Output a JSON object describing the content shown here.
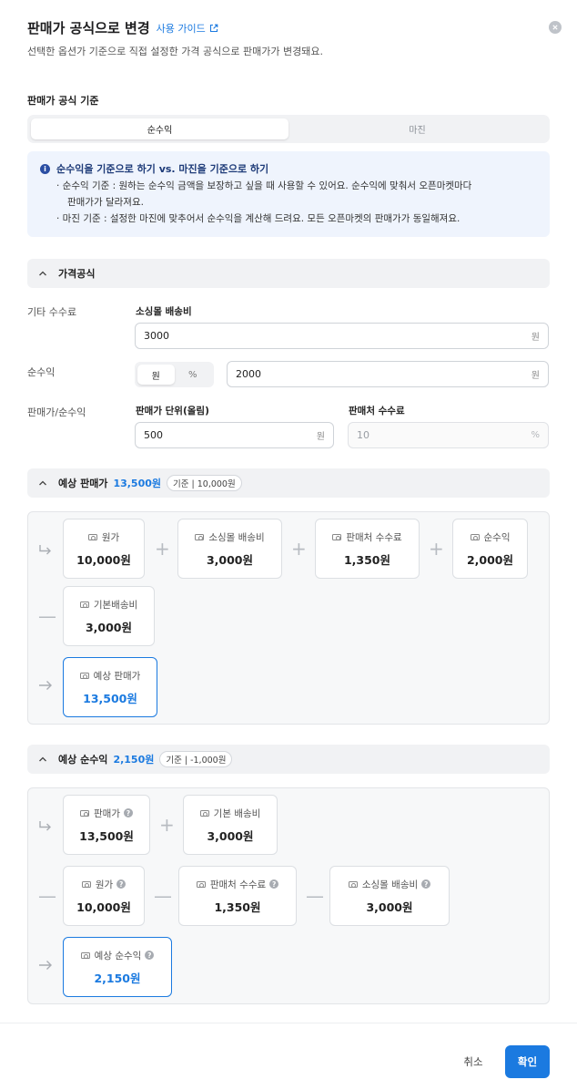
{
  "header": {
    "title": "판매가 공식으로 변경",
    "guide_link": "사용 가이드",
    "subtitle": "선택한 옵션가 기준으로 직접 설정한 가격 공식으로 판매가가 변경돼요."
  },
  "formula_basis": {
    "label": "판매가 공식 기준",
    "tabs": [
      "순수익",
      "마진"
    ],
    "selected": "순수익"
  },
  "info": {
    "title": "순수익을 기준으로 하기 vs. 마진을 기준으로 하기",
    "lines": [
      "· 순수익 기준 : 원하는 순수익 금액을 보장하고 싶을 때 사용할 수 있어요. 순수익에 맞춰서 오픈마켓마다",
      "판매가가 달라져요.",
      "· 마진 기준 : 설정한 마진에 맞추어서 순수익을 계산해 드려요. 모든 오픈마켓의 판매가가 동일해져요."
    ]
  },
  "price_formula": {
    "title": "가격공식",
    "other_fee": {
      "row_label": "기타 수수료",
      "field_label": "소싱몰 배송비",
      "value": "3000",
      "unit": "원"
    },
    "net_profit": {
      "row_label": "순수익",
      "toggle": [
        "원",
        "%"
      ],
      "toggle_selected": "원",
      "value": "2000",
      "unit": "원"
    },
    "price_profit": {
      "row_label": "판매가/순수익",
      "unit_label": "판매가 단위(올림)",
      "unit_value": "500",
      "unit_unit": "원",
      "fee_label": "판매처 수수료",
      "fee_value": "10",
      "fee_unit": "%"
    }
  },
  "expected_price": {
    "title": "예상 판매가",
    "value": "13,500원",
    "badge": "기준 | 10,000원",
    "cards": [
      {
        "label": "원가",
        "value": "10,000원"
      },
      {
        "label": "소싱몰 배송비",
        "value": "3,000원"
      },
      {
        "label": "판매처 수수료",
        "value": "1,350원"
      },
      {
        "label": "순수익",
        "value": "2,000원"
      },
      {
        "label": "기본배송비",
        "value": "3,000원"
      }
    ],
    "ops": [
      "+",
      "+",
      "+",
      "—"
    ],
    "result": {
      "label": "예상 판매가",
      "value": "13,500원"
    }
  },
  "expected_profit": {
    "title": "예상 순수익",
    "value": "2,150원",
    "badge": "기준 | -1,000원",
    "cards": [
      {
        "label": "판매가",
        "value": "13,500원"
      },
      {
        "label": "기본 배송비",
        "value": "3,000원"
      },
      {
        "label": "원가",
        "value": "10,000원"
      },
      {
        "label": "판매처 수수료",
        "value": "1,350원"
      },
      {
        "label": "소싱몰 배송비",
        "value": "3,000원"
      }
    ],
    "ops": [
      "+",
      "—",
      "—",
      "—"
    ],
    "result": {
      "label": "예상 순수익",
      "value": "2,150원"
    }
  },
  "footer": {
    "cancel": "취소",
    "confirm": "확인"
  },
  "colors": {
    "accent": "#1b7ae0",
    "info_bg": "#eff4fd",
    "section_bg": "#f1f2f4"
  }
}
